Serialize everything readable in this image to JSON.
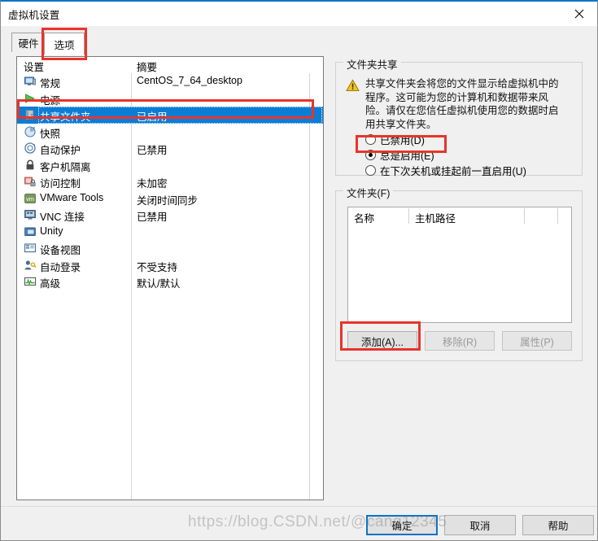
{
  "window": {
    "title": "虚拟机设置",
    "close_label": "✕"
  },
  "tabs": [
    {
      "label": "硬件",
      "active": false
    },
    {
      "label": "选项",
      "active": true
    }
  ],
  "settings_list": {
    "headers": {
      "setting": "设置",
      "summary": "摘要"
    },
    "rows": [
      {
        "icon": "monitor-icon",
        "label": "常规",
        "summary": "CentOS_7_64_desktop",
        "selected": false
      },
      {
        "icon": "play-icon",
        "label": "电源",
        "summary": "",
        "selected": false
      },
      {
        "icon": "folder-icon",
        "label": "共享文件夹",
        "summary": "已启用",
        "selected": true
      },
      {
        "icon": "camera-icon",
        "label": "快照",
        "summary": "",
        "selected": false
      },
      {
        "icon": "autoprotect-icon",
        "label": "自动保护",
        "summary": "已禁用",
        "selected": false
      },
      {
        "icon": "lock-icon",
        "label": "客户机隔离",
        "summary": "",
        "selected": false
      },
      {
        "icon": "access-control-icon",
        "label": "访问控制",
        "summary": "未加密",
        "selected": false
      },
      {
        "icon": "vmware-tools-icon",
        "label": "VMware Tools",
        "summary": "关闭时间同步",
        "selected": false
      },
      {
        "icon": "vnc-icon",
        "label": "VNC 连接",
        "summary": "已禁用",
        "selected": false
      },
      {
        "icon": "unity-icon",
        "label": "Unity",
        "summary": "",
        "selected": false
      },
      {
        "icon": "device-view-icon",
        "label": "设备视图",
        "summary": "",
        "selected": false
      },
      {
        "icon": "auto-login-icon",
        "label": "自动登录",
        "summary": "不受支持",
        "selected": false
      },
      {
        "icon": "advanced-icon",
        "label": "高级",
        "summary": "默认/默认",
        "selected": false
      }
    ]
  },
  "folder_sharing": {
    "group_title": "文件夹共享",
    "warning_icon": "warning-triangle-icon",
    "warning_text": "共享文件夹会将您的文件显示给虚拟机中的程序。这可能为您的计算机和数据带来风险。请仅在您信任虚拟机使用您的数据时启用共享文件夹。",
    "options": [
      {
        "label": "已禁用(D)",
        "accel": "D",
        "checked": false
      },
      {
        "label": "总是启用(E)",
        "accel": "E",
        "checked": true
      },
      {
        "label": "在下次关机或挂起前一直启用(U)",
        "accel": "U",
        "checked": false
      }
    ]
  },
  "folders": {
    "group_title": "文件夹(F)",
    "columns": [
      "名称",
      "主机路径"
    ],
    "rows": [],
    "buttons": [
      {
        "label": "添加(A)...",
        "enabled": true
      },
      {
        "label": "移除(R)",
        "enabled": false
      },
      {
        "label": "属性(P)",
        "enabled": false
      }
    ]
  },
  "footer": {
    "ok": "确定",
    "cancel": "取消",
    "help": "帮助"
  },
  "watermark": "https://blog.CSDN.net/@cang12345",
  "colors": {
    "selection_blue": "#0d7cd5",
    "accent_blue": "#0a74c8",
    "annotation_red": "#e8342a",
    "panel_gray": "#f0f0f0"
  }
}
